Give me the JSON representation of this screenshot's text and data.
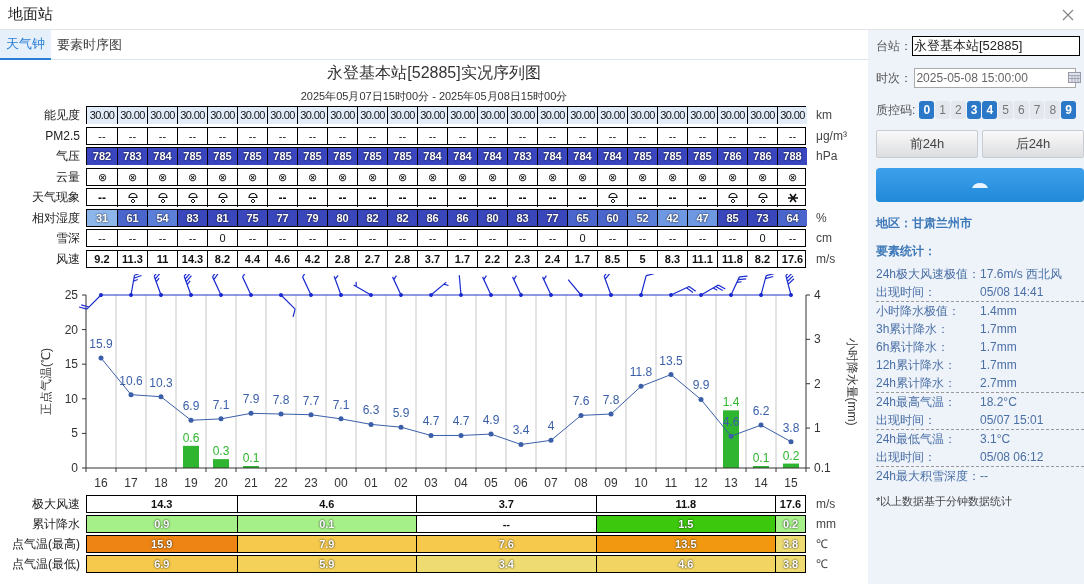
{
  "window": {
    "title": "地面站"
  },
  "tabs": [
    {
      "label": "天气钟",
      "selected": true
    },
    {
      "label": "要素时序图",
      "selected": false
    }
  ],
  "chart_title": "永登基本站[52885]实况序列图",
  "chart_subtitle": "2025年05月07日15时00分 - 2025年05月08日15时00分",
  "element_table": {
    "rows": [
      {
        "label": "能见度",
        "unit": "km",
        "kind": "visibility",
        "cells": [
          "30.00",
          "30.00",
          "30.00",
          "30.00",
          "30.00",
          "30.00",
          "30.00",
          "30.00",
          "30.00",
          "30.00",
          "30.00",
          "30.00",
          "30.00",
          "30.00",
          "30.00",
          "30.00",
          "30.00",
          "30.00",
          "30.00",
          "30.00",
          "30.00",
          "30.00",
          "30.00",
          "30.00"
        ]
      },
      {
        "label": "PM2.5",
        "unit": "μg/m³",
        "kind": "plain",
        "cells": [
          "--",
          "--",
          "--",
          "--",
          "--",
          "--",
          "--",
          "--",
          "--",
          "--",
          "--",
          "--",
          "--",
          "--",
          "--",
          "--",
          "--",
          "--",
          "--",
          "--",
          "--",
          "--",
          "--",
          "--"
        ]
      },
      {
        "label": "气压",
        "unit": "hPa",
        "kind": "pressure",
        "cells": [
          "782",
          "783",
          "784",
          "785",
          "785",
          "785",
          "785",
          "785",
          "785",
          "785",
          "785",
          "784",
          "784",
          "784",
          "783",
          "784",
          "784",
          "784",
          "785",
          "785",
          "785",
          "786",
          "786",
          "788"
        ]
      },
      {
        "label": "云量",
        "kind": "plain",
        "cells": [
          "⊗",
          "⊗",
          "⊗",
          "⊗",
          "⊗",
          "⊗",
          "⊗",
          "⊗",
          "⊗",
          "⊗",
          "⊗",
          "⊗",
          "⊗",
          "⊗",
          "⊗",
          "⊗",
          "⊗",
          "⊗",
          "⊗",
          "⊗",
          "⊗",
          "⊗",
          "⊗",
          "⊗"
        ]
      },
      {
        "label": "天气现象",
        "kind": "weather",
        "cells": [
          {
            "kind": "text",
            "text": "--"
          },
          {
            "kind": "shower"
          },
          {
            "kind": "shower"
          },
          {
            "kind": "shower"
          },
          {
            "kind": "shower"
          },
          {
            "kind": "shower"
          },
          {
            "kind": "text",
            "text": "--"
          },
          {
            "kind": "text",
            "text": "--"
          },
          {
            "kind": "text",
            "text": "--"
          },
          {
            "kind": "text",
            "text": "--"
          },
          {
            "kind": "text",
            "text": "--"
          },
          {
            "kind": "text",
            "text": "--"
          },
          {
            "kind": "text",
            "text": "--"
          },
          {
            "kind": "text",
            "text": "--"
          },
          {
            "kind": "text",
            "text": "--"
          },
          {
            "kind": "text",
            "text": "--"
          },
          {
            "kind": "text",
            "text": "--"
          },
          {
            "kind": "shower"
          },
          {
            "kind": "text",
            "text": "--"
          },
          {
            "kind": "text",
            "text": "--"
          },
          {
            "kind": "text",
            "text": "--"
          },
          {
            "kind": "shower"
          },
          {
            "kind": "shower"
          },
          {
            "kind": "snow"
          }
        ]
      },
      {
        "label": "相对湿度",
        "unit": "%",
        "kind": "humidity",
        "cells": [
          "31",
          "61",
          "54",
          "83",
          "81",
          "75",
          "77",
          "79",
          "80",
          "82",
          "82",
          "86",
          "86",
          "80",
          "83",
          "77",
          "65",
          "60",
          "52",
          "42",
          "47",
          "85",
          "73",
          "64"
        ]
      },
      {
        "label": "雪深",
        "unit": "cm",
        "kind": "plain",
        "cells": [
          "--",
          "--",
          "--",
          "--",
          "0",
          "--",
          "--",
          "--",
          "--",
          "--",
          "--",
          "--",
          "--",
          "--",
          "--",
          "--",
          "0",
          "--",
          "--",
          "--",
          "--",
          "--",
          "0",
          "--"
        ]
      },
      {
        "label": "风速",
        "unit": "m/s",
        "kind": "wind",
        "cells": [
          "9.2",
          "11.3",
          "11",
          "14.3",
          "8.2",
          "4.4",
          "4.6",
          "4.2",
          "2.8",
          "2.7",
          "2.8",
          "3.7",
          "1.7",
          "2.2",
          "2.3",
          "2.4",
          "1.7",
          "8.5",
          "5",
          "8.3",
          "11.1",
          "11.8",
          "8.2",
          "17.6"
        ]
      }
    ]
  },
  "temperature_chart": {
    "chart_data": {
      "type": "line",
      "ylabel": "正点气温(℃)",
      "categories": [
        "16",
        "17",
        "18",
        "19",
        "20",
        "21",
        "22",
        "23",
        "00",
        "01",
        "02",
        "03",
        "04",
        "05",
        "06",
        "07",
        "08",
        "09",
        "10",
        "11",
        "12",
        "13",
        "14",
        "15"
      ],
      "ylim": [
        0,
        25
      ],
      "yticks": [
        0,
        5,
        10,
        15,
        20,
        25
      ],
      "data_labels": true,
      "values": [
        15.9,
        10.6,
        10.3,
        6.9,
        7.1,
        7.9,
        7.8,
        7.7,
        7.1,
        6.3,
        5.9,
        4.7,
        4.7,
        4.9,
        3.4,
        4,
        7.6,
        7.8,
        11.8,
        13.5,
        9.9,
        4.6,
        6.2,
        3.8
      ]
    }
  },
  "precipitation_chart": {
    "chart_data": {
      "type": "bar",
      "ylabel": "小时降水量(mm)",
      "ylim": [
        0.1,
        4
      ],
      "yticks": [
        {
          "value": 0.1,
          "label": "0.1"
        },
        1,
        2,
        3,
        4
      ],
      "data_labels": true,
      "values": [
        null,
        null,
        null,
        0.6,
        0.3,
        0.1,
        null,
        null,
        null,
        null,
        null,
        null,
        null,
        null,
        null,
        null,
        null,
        null,
        null,
        null,
        null,
        1.4,
        0.1,
        0.2
      ]
    }
  },
  "summary_table": {
    "rows": [
      {
        "label": "极大风速",
        "unit": "m/s",
        "cells": [
          {
            "text": "14.3",
            "color": "#ffffff"
          },
          {
            "text": "4.6",
            "color": "#ffffff"
          },
          {
            "text": "3.7",
            "color": "#ffffff"
          },
          {
            "text": "11.8",
            "color": "#ffffff"
          },
          {
            "text": "17.6",
            "color": "#ffffff"
          }
        ]
      },
      {
        "label": "累计降水",
        "unit": "mm",
        "cells": [
          {
            "text": "0.9",
            "color": "#a6f08a"
          },
          {
            "text": "0.1",
            "color": "#a6f08a"
          },
          {
            "text": "--",
            "color": "#ffffff"
          },
          {
            "text": "1.5",
            "color": "#3cc80c"
          },
          {
            "text": "0.2",
            "color": "#a6f08a"
          }
        ]
      },
      {
        "label": "点气温(最高)",
        "unit": "℃",
        "cells": [
          {
            "text": "15.9",
            "color": "#ee8414"
          },
          {
            "text": "7.9",
            "color": "#f6c94c"
          },
          {
            "text": "7.6",
            "color": "#f6c94c"
          },
          {
            "text": "13.5",
            "color": "#f19810"
          },
          {
            "text": "3.8",
            "color": "#eedc72"
          }
        ]
      },
      {
        "label": "点气温(最低)",
        "unit": "℃",
        "cells": [
          {
            "text": "6.9",
            "color": "#f6c94c"
          },
          {
            "text": "5.9",
            "color": "#f4d25a"
          },
          {
            "text": "3.4",
            "color": "#eedc72"
          },
          {
            "text": "4.6",
            "color": "#f2d462"
          },
          {
            "text": "3.8",
            "color": "#eedc72"
          }
        ]
      }
    ]
  },
  "panel": {
    "station": {
      "label": "台站：",
      "value": "永登基本站[52885]"
    },
    "time": {
      "label": "时次：",
      "value": "2025-05-08 15:00:00"
    },
    "qc": {
      "label": "质控码:",
      "codes": [
        {
          "label": "0",
          "selected": true
        },
        {
          "label": "1",
          "selected": false
        },
        {
          "label": "2",
          "selected": false
        },
        {
          "label": "3",
          "selected": true
        },
        {
          "label": "4",
          "selected": true
        },
        {
          "label": "5",
          "selected": false
        },
        {
          "label": "6",
          "selected": false
        },
        {
          "label": "7",
          "selected": false
        },
        {
          "label": "8",
          "selected": false
        },
        {
          "label": "9",
          "selected": true
        }
      ]
    },
    "buttons": [
      "前24h",
      "后24h"
    ],
    "region": "地区：甘肃兰州市",
    "stats_title": "要素统计：",
    "stat_groups": [
      [
        {
          "label": "24h极大风速极值：",
          "value": "17.6m/s 西北风",
          "kind": "inline"
        },
        {
          "label": "出现时间：",
          "value": "05/08 14:41"
        }
      ],
      [
        {
          "label": "小时降水极值：",
          "value": "1.4mm"
        },
        {
          "label": "3h累计降水：",
          "value": "1.7mm"
        },
        {
          "label": "6h累计降水：",
          "value": "1.7mm"
        },
        {
          "label": "12h累计降水：",
          "value": "1.7mm"
        },
        {
          "label": "24h累计降水：",
          "value": "2.7mm"
        }
      ],
      [
        {
          "label": "24h最高气温：",
          "value": "18.2°C"
        },
        {
          "label": "出现时间：",
          "value": "05/07 15:01"
        }
      ],
      [
        {
          "label": "24h最低气温：",
          "value": "3.1°C"
        },
        {
          "label": "出现时间：",
          "value": "05/08 06:12"
        }
      ],
      [
        {
          "label": "24h最大积雪深度：",
          "value": "--",
          "kind": "inline"
        }
      ]
    ],
    "footnote": "*以上数据基于分钟数据统计"
  }
}
